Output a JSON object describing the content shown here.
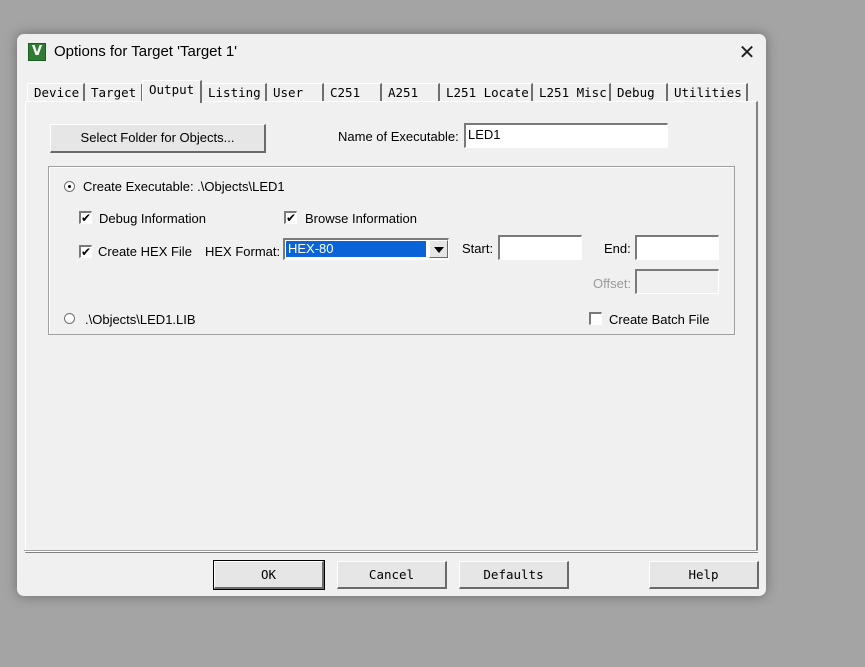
{
  "window": {
    "title": "Options for Target 'Target 1'",
    "icon": "keil-uvision-icon",
    "close_symbol": "✕"
  },
  "tabs": [
    {
      "label": "Device"
    },
    {
      "label": "Target"
    },
    {
      "label": "Output",
      "active": true
    },
    {
      "label": "Listing"
    },
    {
      "label": "User"
    },
    {
      "label": "C251"
    },
    {
      "label": "A251"
    },
    {
      "label": "L251 Locate"
    },
    {
      "label": "L251 Misc"
    },
    {
      "label": "Debug"
    },
    {
      "label": "Utilities"
    }
  ],
  "output": {
    "select_folder_label": "Select Folder for Objects...",
    "name_of_executable_label": "Name of Executable:",
    "name_of_executable_value": "LED1",
    "create_executable_label": "Create Executable:  .\\Objects\\LED1",
    "create_executable_checked": true,
    "debug_information_label": "Debug Information",
    "debug_information_checked": true,
    "browse_information_label": "Browse Information",
    "browse_information_checked": true,
    "create_hex_label": "Create HEX File",
    "create_hex_checked": true,
    "hex_format_label": "HEX Format:",
    "hex_format_value": "HEX-80",
    "start_label": "Start:",
    "start_value": "",
    "end_label": "End:",
    "end_value": "",
    "offset_label": "Offset:",
    "offset_value": "",
    "create_library_label": ".\\Objects\\LED1.LIB",
    "create_library_checked": false,
    "create_batch_label": "Create Batch File",
    "create_batch_checked": false
  },
  "buttons": {
    "ok": "OK",
    "cancel": "Cancel",
    "defaults": "Defaults",
    "help": "Help"
  },
  "check_mark": "✔"
}
